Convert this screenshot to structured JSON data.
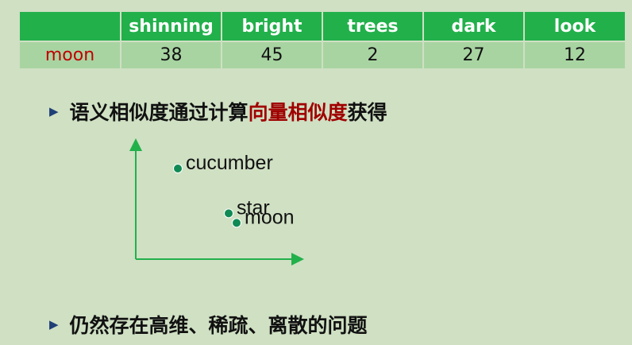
{
  "table": {
    "corner": "",
    "headers": [
      "shinning",
      "bright",
      "trees",
      "dark",
      "look"
    ],
    "row_label": "moon",
    "values": [
      "38",
      "45",
      "2",
      "27",
      "12"
    ]
  },
  "bullets": [
    {
      "prefix": "语义相似度通过计算",
      "highlight": "向量相似度",
      "suffix": "获得"
    },
    {
      "prefix": "仍然存在高维、稀疏、离散的问题",
      "highlight": "",
      "suffix": ""
    }
  ],
  "chart_data": {
    "type": "scatter",
    "title": "",
    "xlabel": "",
    "ylabel": "",
    "points": [
      {
        "label": "cucumber",
        "x": 1,
        "y": 9
      },
      {
        "label": "star",
        "x": 4.2,
        "y": 4.3
      },
      {
        "label": "moon",
        "x": 4.7,
        "y": 3.3
      }
    ],
    "xlim": [
      0,
      10
    ],
    "ylim": [
      0,
      12
    ],
    "grid": false,
    "point_color": "#0f8a55",
    "axis_color": "#22b04b"
  },
  "colors": {
    "background": "#cfe0c3",
    "header_bg": "#22b04b",
    "cell_bg": "#a8d4a2",
    "row_label": "#c00000",
    "highlight": "#a00000",
    "bullet_marker": "#1f3f77"
  },
  "icons": {
    "bullet": "triangle-bullet-icon"
  }
}
